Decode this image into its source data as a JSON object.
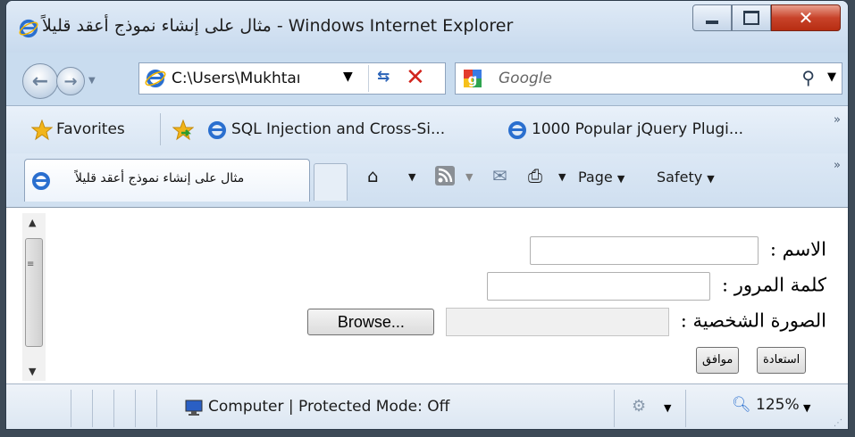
{
  "window": {
    "title": "مثال على إنشاء نموذج أعقد قليلاً - Windows Internet Explorer"
  },
  "navbar": {
    "address": "C:\\Users\\Mukhtaı",
    "search_placeholder": "Google"
  },
  "favorites_bar": {
    "favorites_label": "Favorites",
    "links": [
      "SQL Injection and Cross-Si...",
      "1000 Popular jQuery Plugi..."
    ]
  },
  "command_bar": {
    "tab_title": "مثال على إنشاء نموذج أعقد قليلاً",
    "page_label": "Page",
    "safety_label": "Safety"
  },
  "form": {
    "name_label": "الاسم :",
    "password_label": "كلمة المرور :",
    "photo_label": "الصورة الشخصية :",
    "browse_label": "Browse...",
    "submit_label": "موافق",
    "reset_label": "استعادة"
  },
  "status_bar": {
    "zone": "Computer | Protected Mode: Off",
    "zoom": "125%"
  },
  "colors": {
    "ie_blue": "#2a6fcf",
    "close_red": "#c8432a",
    "favorites_star": "#f2b51b"
  },
  "icons": [
    "ie-logo-icon",
    "back-arrow-icon",
    "forward-arrow-icon",
    "refresh-icon",
    "stop-icon",
    "google-icon",
    "search-icon",
    "favorites-star-icon",
    "add-favorite-icon",
    "home-icon",
    "rss-feed-icon",
    "read-mail-icon",
    "print-icon",
    "computer-icon",
    "zoom-icon",
    "security-icon"
  ]
}
